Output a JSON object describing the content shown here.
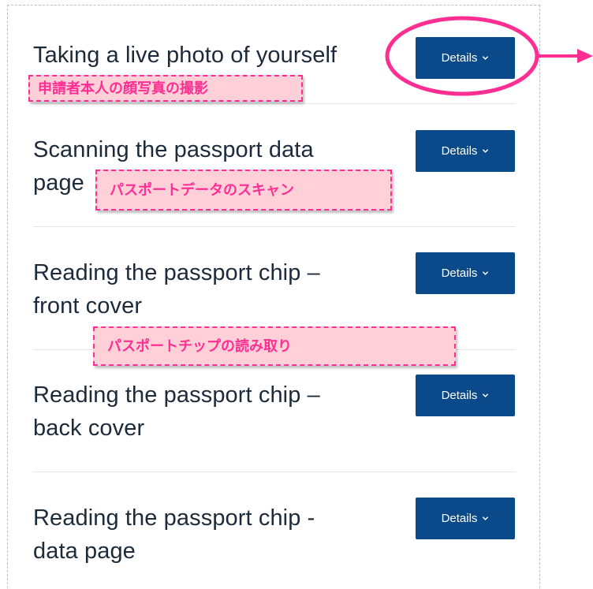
{
  "steps": [
    {
      "title_lines": [
        "Taking a live photo of yourself"
      ],
      "button_label": "Details"
    },
    {
      "title_lines": [
        "Scanning the passport data",
        "page"
      ],
      "button_label": "Details"
    },
    {
      "title_lines": [
        "Reading the passport chip –",
        "front cover"
      ],
      "button_label": "Details"
    },
    {
      "title_lines": [
        "Reading the passport chip –",
        "back cover"
      ],
      "button_label": "Details"
    },
    {
      "title_lines": [
        "Reading the passport chip -",
        "data page"
      ],
      "button_label": "Details"
    }
  ],
  "annotations": {
    "photo": "申請者本人の顔写真の撮影",
    "scan": "パスポートデータのスキャン",
    "chip": "パスポートチップの読み取り"
  },
  "colors": {
    "button": "#0a4a8a",
    "annotation_pink": "#ff2e92",
    "annotation_fill": "#ffd0d8",
    "title_text": "#1c2a3a"
  },
  "icons": {
    "button_icon": "chevron-down-icon",
    "callout": "circle-highlight-arrow"
  }
}
